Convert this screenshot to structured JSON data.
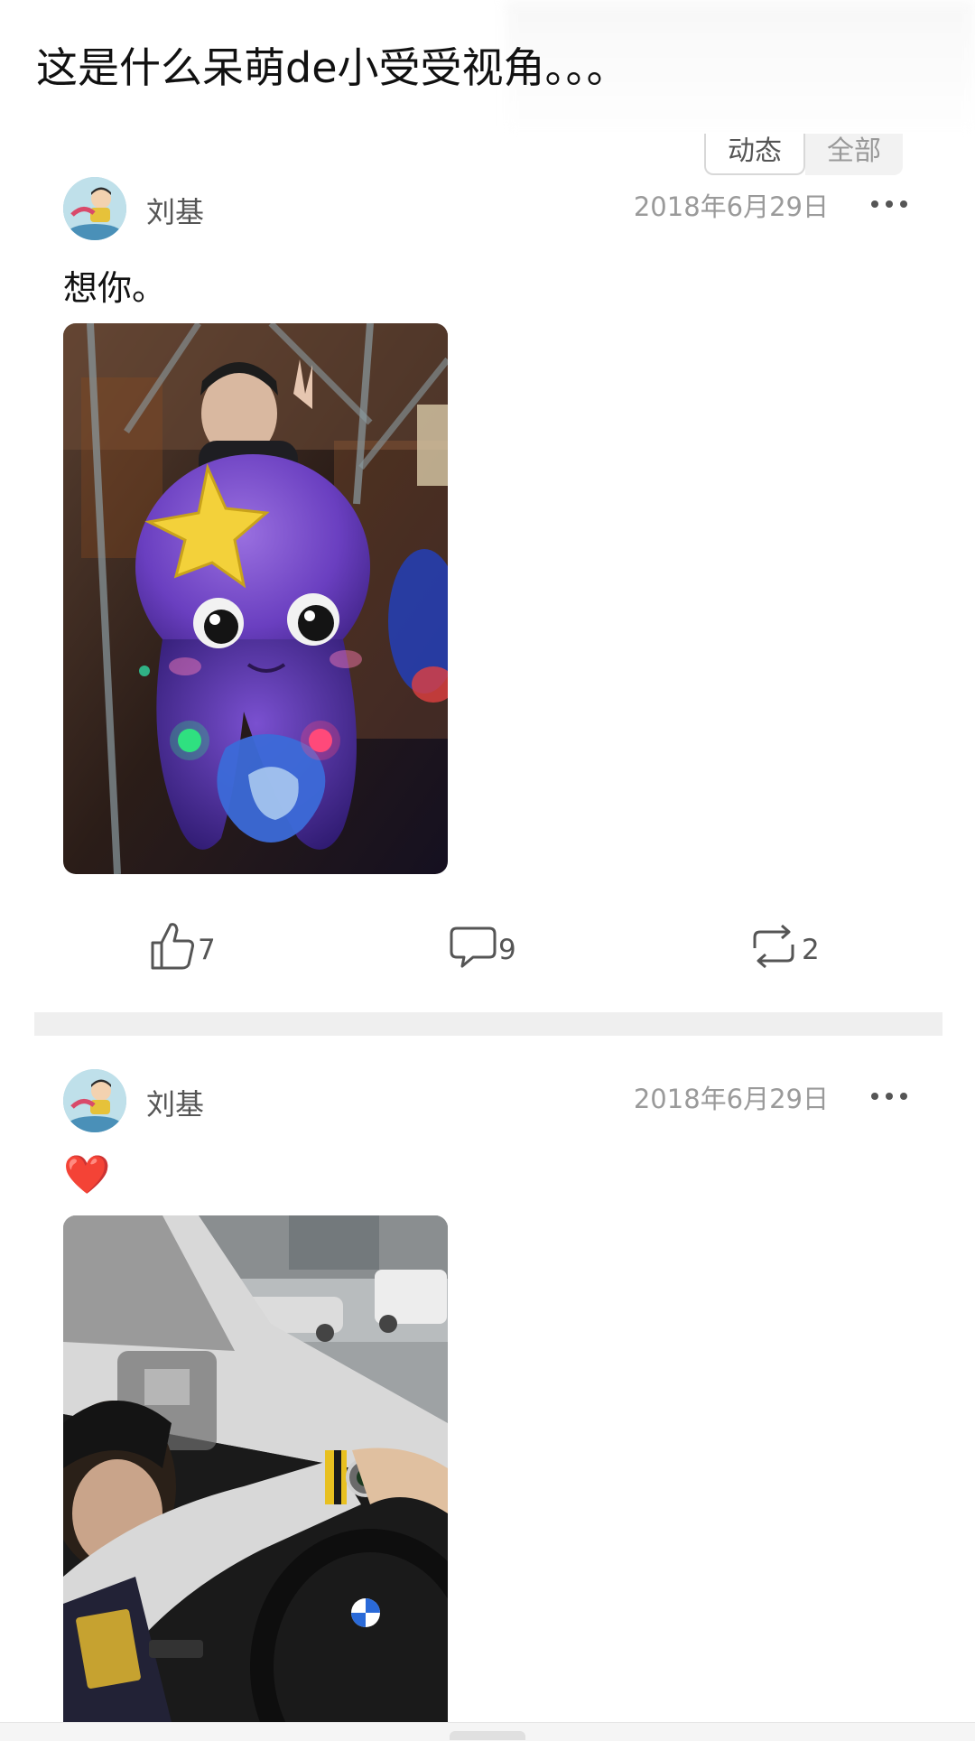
{
  "caption": "这是什么呆萌de小受受视角。。。",
  "tabs": [
    {
      "label": "动态",
      "active": true
    },
    {
      "label": "全部",
      "active": false
    }
  ],
  "posts": [
    {
      "username": "刘基",
      "date": "2018年6月29日",
      "text": "想你。",
      "photo": "octopus-ride-selfie",
      "likes": "7",
      "comments": "9",
      "reposts": "2"
    },
    {
      "username": "刘基",
      "date": "2018年6月29日",
      "text": "❤️",
      "photo": "car-driving-selfie"
    }
  ],
  "icons": {
    "like": "thumbs-up-icon",
    "comment": "comment-bubble-icon",
    "repost": "repost-arrows-icon",
    "more": "more-dots-icon"
  },
  "colors": {
    "text": "#111111",
    "meta": "#9a9a9a",
    "divider": "#efefef",
    "heart": "#e0242f"
  }
}
